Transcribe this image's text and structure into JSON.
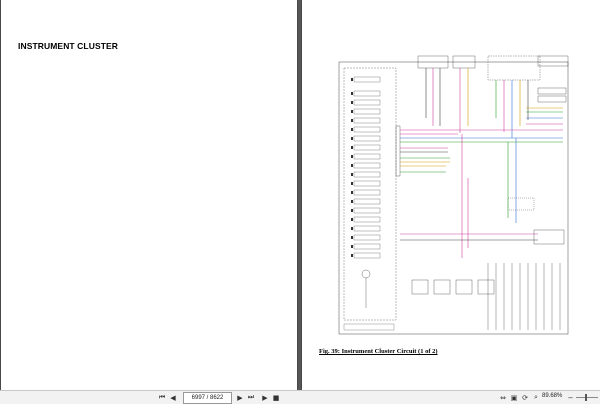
{
  "left_page": {
    "heading": "INSTRUMENT CLUSTER"
  },
  "right_page": {
    "figure_caption": "Fig. 39: Instrument Cluster Circuit (1 of 2)"
  },
  "toolbar": {
    "page_display": "6997 / 8622",
    "zoom_level": "89.68%",
    "icons": [
      "arrow-up-icon",
      "arrow-down-icon",
      "first-page-icon",
      "previous-page-icon",
      "next-page-icon",
      "last-page-icon",
      "play-icon",
      "stop-icon",
      "fit-width-icon",
      "fit-page-icon",
      "rotate-icon",
      "search-icon",
      "zoom-out-icon",
      "zoom-in-icon"
    ]
  }
}
